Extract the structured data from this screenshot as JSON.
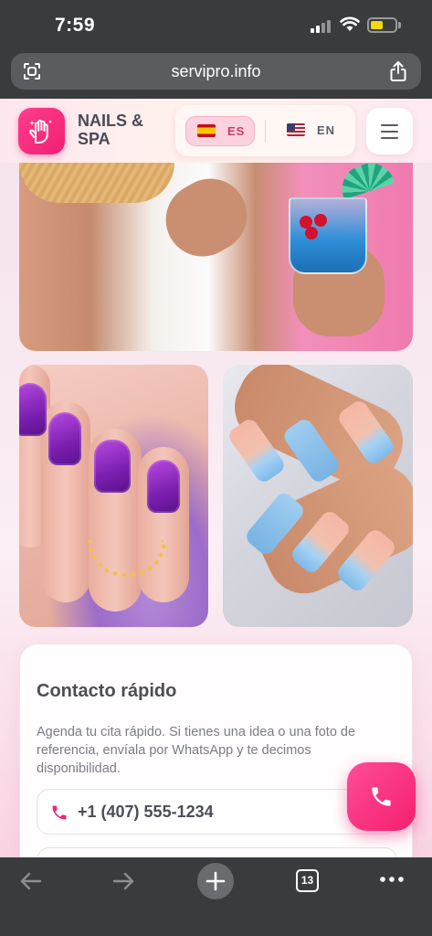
{
  "status_bar": {
    "time": "7:59"
  },
  "browser": {
    "url": "servipro.info",
    "tab_count": "13"
  },
  "site": {
    "brand_line1": "NAILS &",
    "brand_line2": "SPA",
    "lang": {
      "es_code": "ES",
      "en_code": "EN",
      "active": "ES"
    }
  },
  "contact": {
    "title": "Contacto rápido",
    "description": "Agenda tu cita rápido. Si tienes una idea o una foto de referencia, envíala por WhatsApp y te decimos disponibilidad.",
    "phone": "+1 (407) 555-1234"
  },
  "colors": {
    "brand_pink": "#f4206f",
    "text_dark": "#4b4d57",
    "text_muted": "#7a7c86",
    "browser_chrome": "#3a3b3d"
  },
  "icons": {
    "reader": "reader-mode-icon",
    "share": "share-icon",
    "logo": "hand-sparkle-icon",
    "menu": "hamburger-menu-icon",
    "phone": "phone-icon",
    "back": "arrow-left-icon",
    "forward": "arrow-right-icon",
    "new_tab": "plus-icon",
    "more": "more-dots-icon"
  }
}
